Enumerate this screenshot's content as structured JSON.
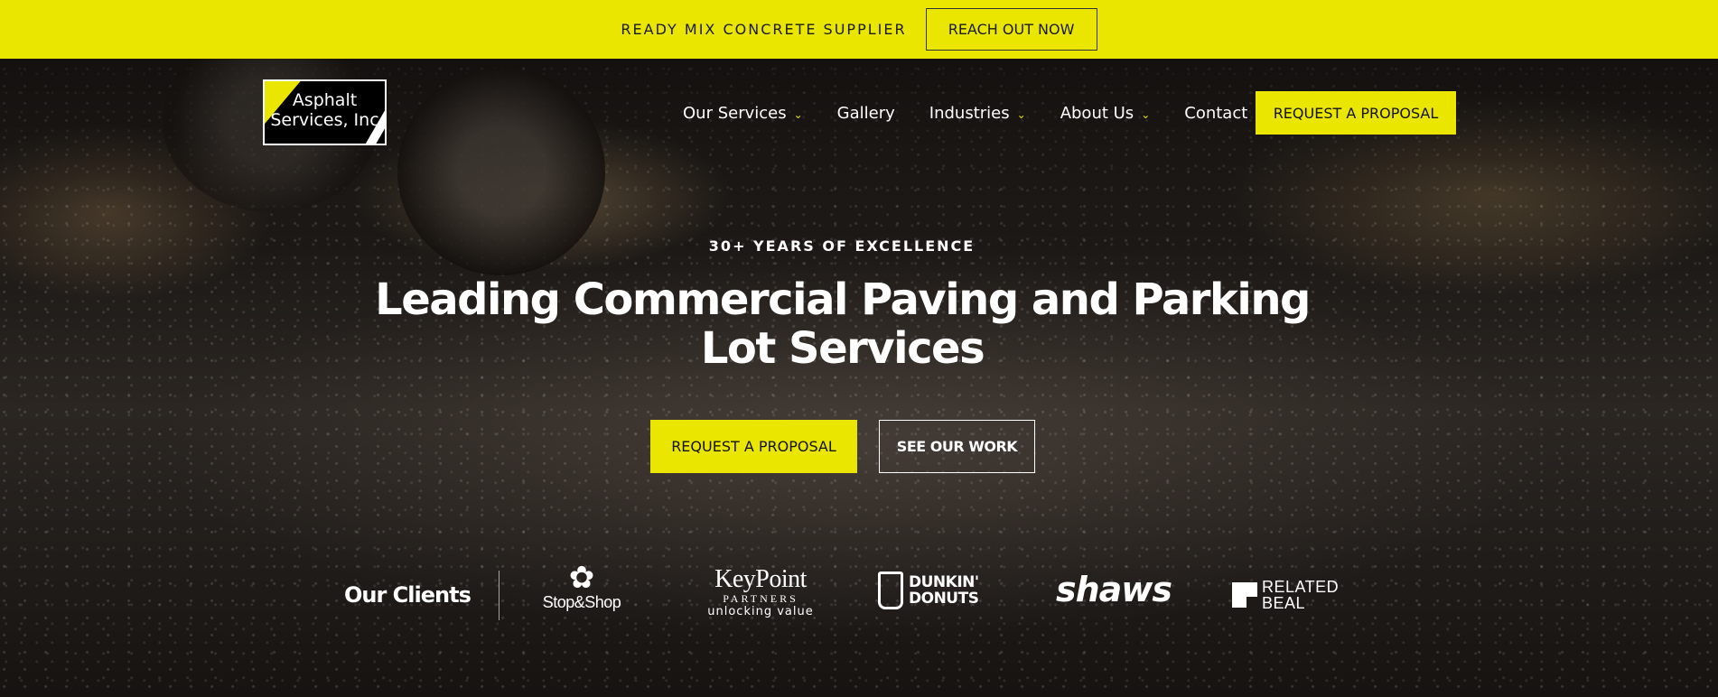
{
  "topbar": {
    "text": "READY MIX CONCRETE SUPPLIER",
    "button_label": "REACH OUT NOW"
  },
  "logo": {
    "line1": "Asphalt",
    "line2": "Services, Inc"
  },
  "nav": {
    "items": [
      {
        "label": "Our Services",
        "has_dropdown": true
      },
      {
        "label": "Gallery",
        "has_dropdown": false
      },
      {
        "label": "Industries",
        "has_dropdown": true
      },
      {
        "label": "About Us",
        "has_dropdown": true
      },
      {
        "label": "Contact",
        "has_dropdown": false
      }
    ],
    "cta_label": "REQUEST A PROPOSAL"
  },
  "hero": {
    "eyebrow": "30+ YEARS OF EXCELLENCE",
    "headline": "Leading Commercial Paving and Parking Lot Services",
    "primary_button": "REQUEST A PROPOSAL",
    "secondary_button": "SEE OUR WORK"
  },
  "clients": {
    "label": "Our Clients",
    "stop_shop": "Stop&Shop",
    "keypoint_name": "KeyPoint",
    "keypoint_sub": "PARTNERS",
    "keypoint_tag": "unlocking value",
    "dunkin_line1": "DUNKIN'",
    "dunkin_line2": "DONUTS",
    "shaws": "shaws",
    "related_line1": "RELATED",
    "related_line2": "BEAL"
  },
  "colors": {
    "accent": "#ebe600",
    "text_dark": "#1a1a1a",
    "text_light": "#ffffff"
  }
}
